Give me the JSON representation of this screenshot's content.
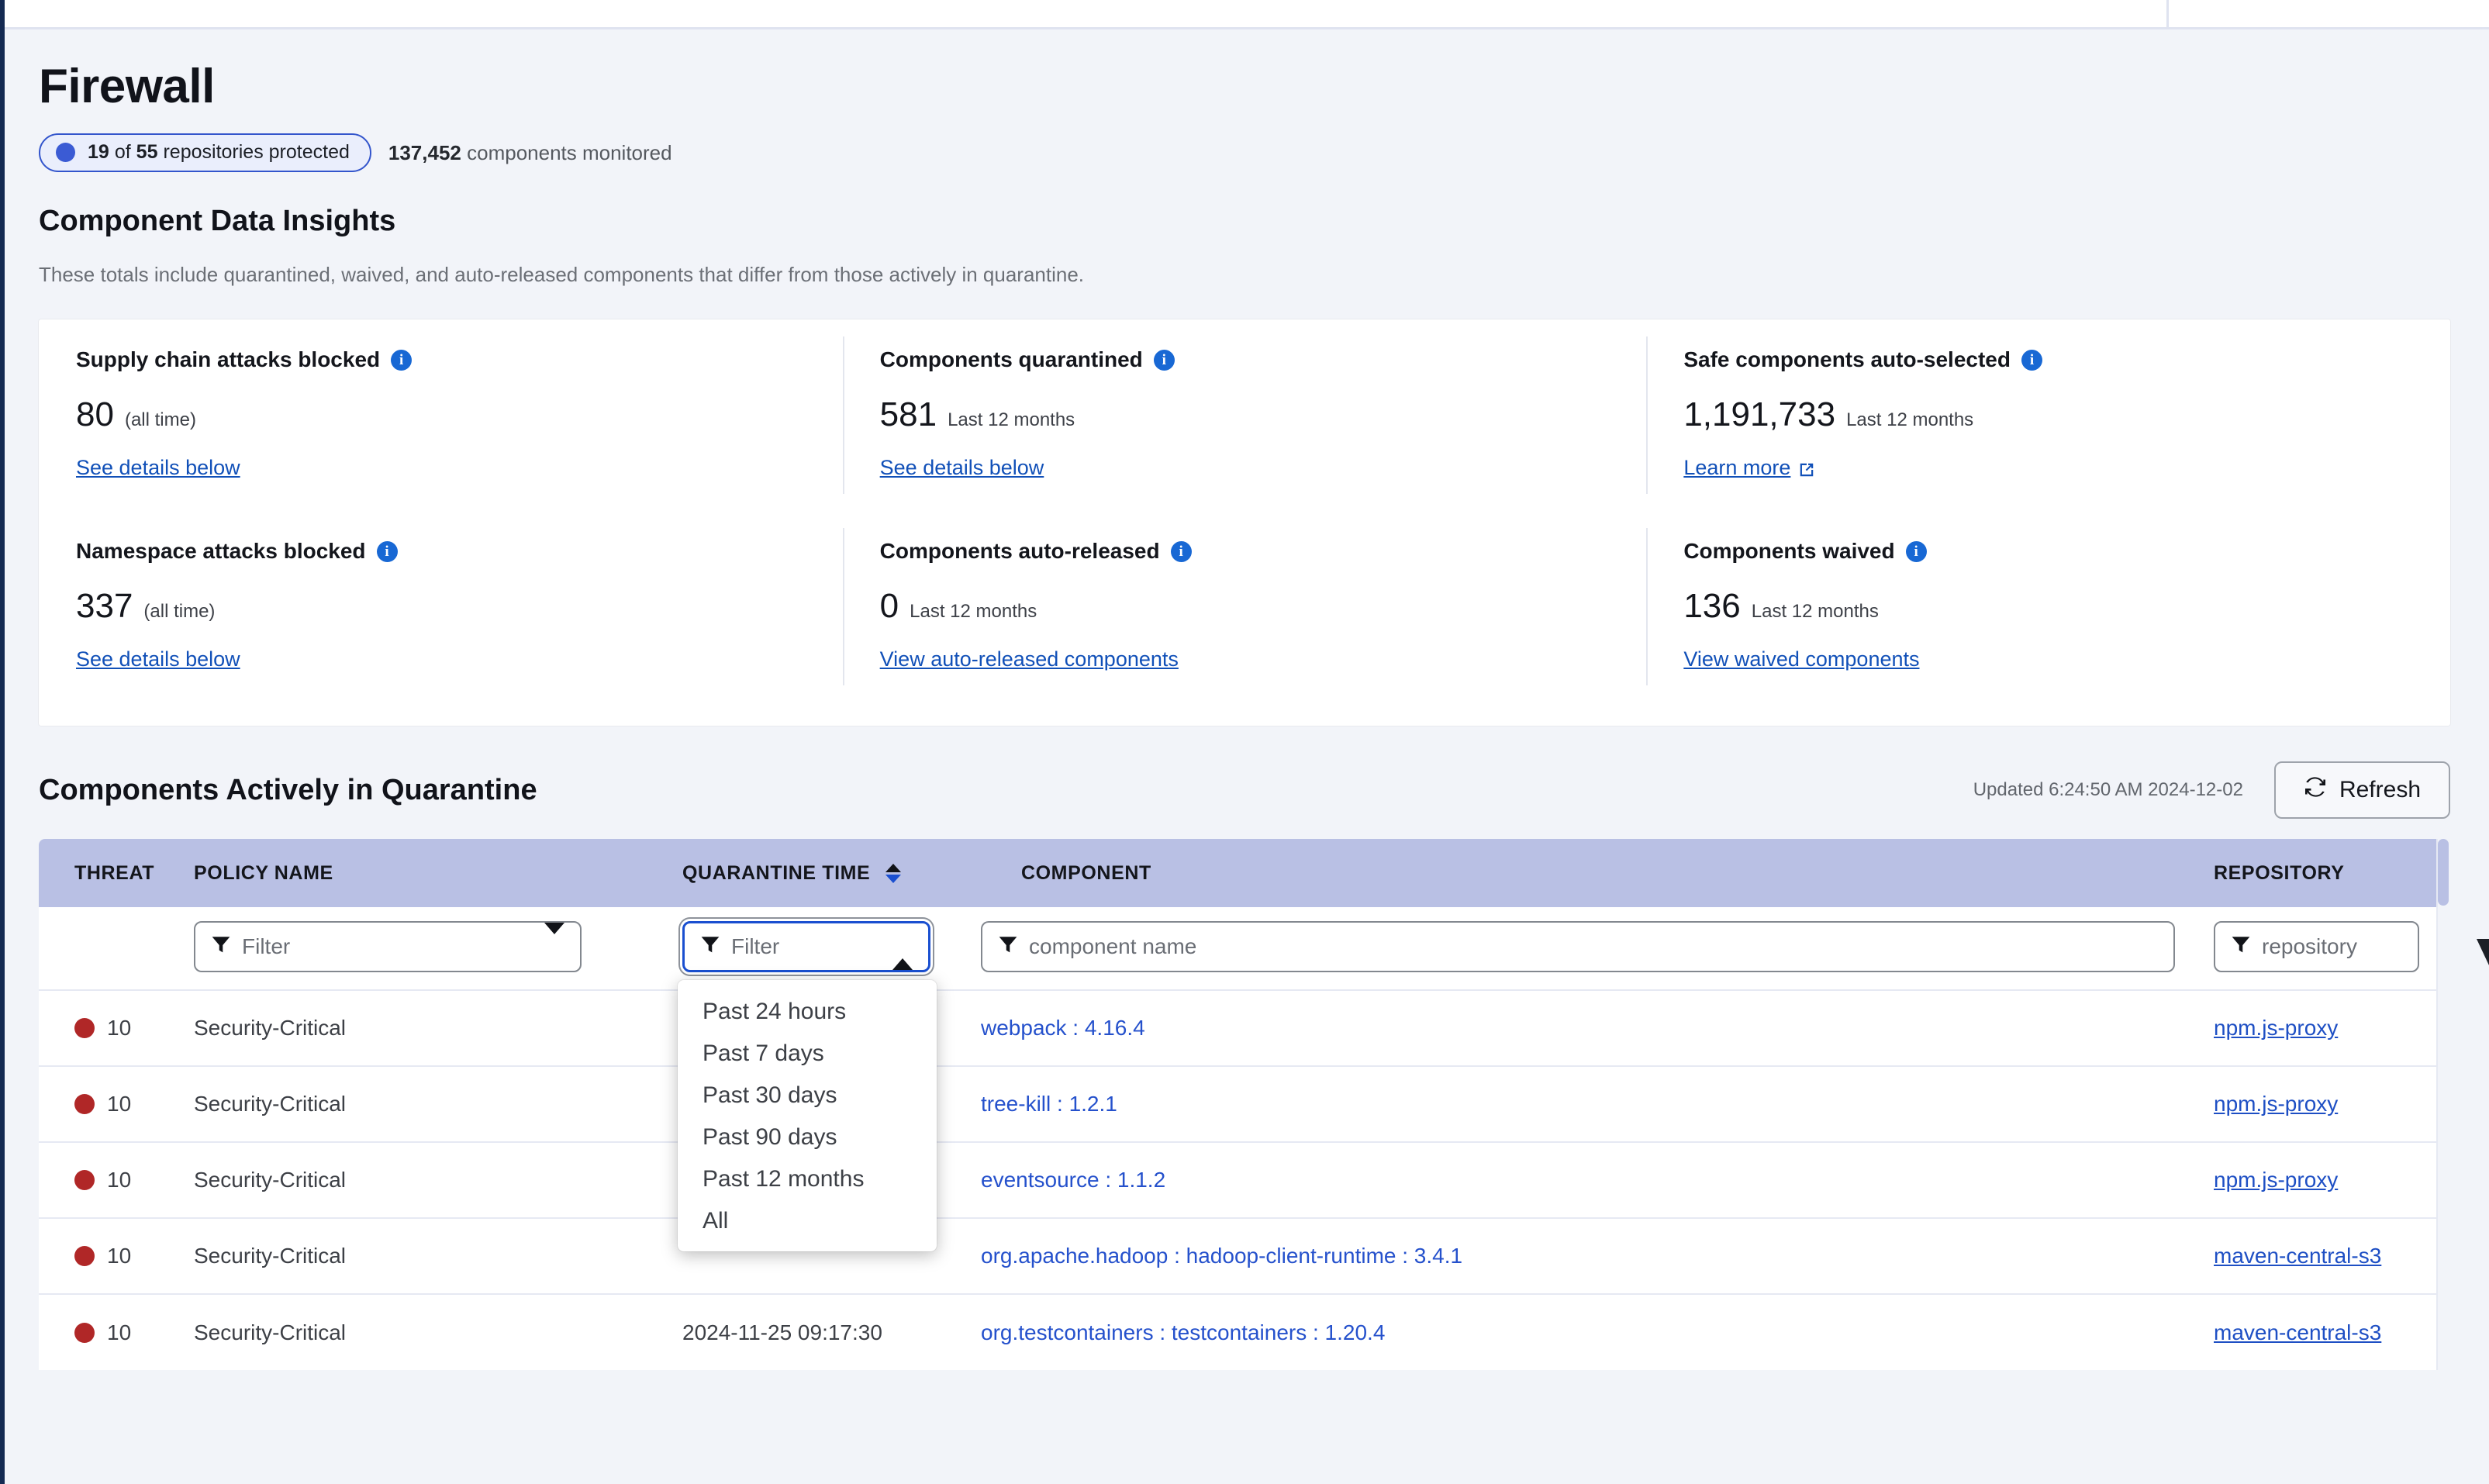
{
  "header": {
    "title": "Firewall",
    "pill": {
      "protected_count": "19",
      "of_text": "of",
      "total_count": "55",
      "suffix": "repositories protected",
      "dot_color": "#3b5bd4"
    },
    "monitored_count": "137,452",
    "monitored_label": "components monitored"
  },
  "insights": {
    "title": "Component Data Insights",
    "subtitle": "These totals include quarantined, waived, and auto-released components that differ from those actively in quarantine.",
    "cards": [
      {
        "title": "Supply chain attacks blocked",
        "value": "80",
        "period": "(all time)",
        "link": "See details below",
        "external": false
      },
      {
        "title": "Components quarantined",
        "value": "581",
        "period": "Last 12 months",
        "link": "See details below",
        "external": false
      },
      {
        "title": "Safe components auto-selected",
        "value": "1,191,733",
        "period": "Last 12 months",
        "link": "Learn more",
        "external": true
      },
      {
        "title": "Namespace attacks blocked",
        "value": "337",
        "period": "(all time)",
        "link": "See details below",
        "external": false
      },
      {
        "title": "Components auto-released",
        "value": "0",
        "period": "Last 12 months",
        "link": "View auto-released components",
        "external": false
      },
      {
        "title": "Components waived",
        "value": "136",
        "period": "Last 12 months",
        "link": "View waived components",
        "external": false
      }
    ]
  },
  "quarantine": {
    "title": "Components Actively in Quarantine",
    "updated": "Updated 6:24:50 AM 2024-12-02",
    "refresh_label": "Refresh",
    "columns": {
      "threat": "THREAT",
      "policy_name": "POLICY NAME",
      "quarantine_time": "QUARANTINE TIME",
      "component": "COMPONENT",
      "repository": "REPOSITORY"
    },
    "filters": {
      "policy_placeholder": "Filter",
      "time_placeholder": "Filter",
      "component_placeholder": "component name",
      "repository_placeholder": "repository"
    },
    "time_dropdown": {
      "open": true,
      "options": [
        "Past 24 hours",
        "Past 7 days",
        "Past 30 days",
        "Past 90 days",
        "Past 12 months",
        "All"
      ]
    },
    "rows": [
      {
        "threat_score": "10",
        "threat_color": "#b02727",
        "policy_name": "Security-Critical",
        "quarantine_time": "",
        "component": "webpack : 4.16.4",
        "repository": "npm.js-proxy"
      },
      {
        "threat_score": "10",
        "threat_color": "#b02727",
        "policy_name": "Security-Critical",
        "quarantine_time": "",
        "component": "tree-kill : 1.2.1",
        "repository": "npm.js-proxy"
      },
      {
        "threat_score": "10",
        "threat_color": "#b02727",
        "policy_name": "Security-Critical",
        "quarantine_time": "",
        "component": "eventsource : 1.1.2",
        "repository": "npm.js-proxy"
      },
      {
        "threat_score": "10",
        "threat_color": "#b02727",
        "policy_name": "Security-Critical",
        "quarantine_time": "",
        "component": "org.apache.hadoop : hadoop-client-runtime : 3.4.1",
        "repository": "maven-central-s3"
      },
      {
        "threat_score": "10",
        "threat_color": "#b02727",
        "policy_name": "Security-Critical",
        "quarantine_time": "2024-11-25 09:17:30",
        "component": "org.testcontainers : testcontainers : 1.20.4",
        "repository": "maven-central-s3"
      }
    ]
  }
}
